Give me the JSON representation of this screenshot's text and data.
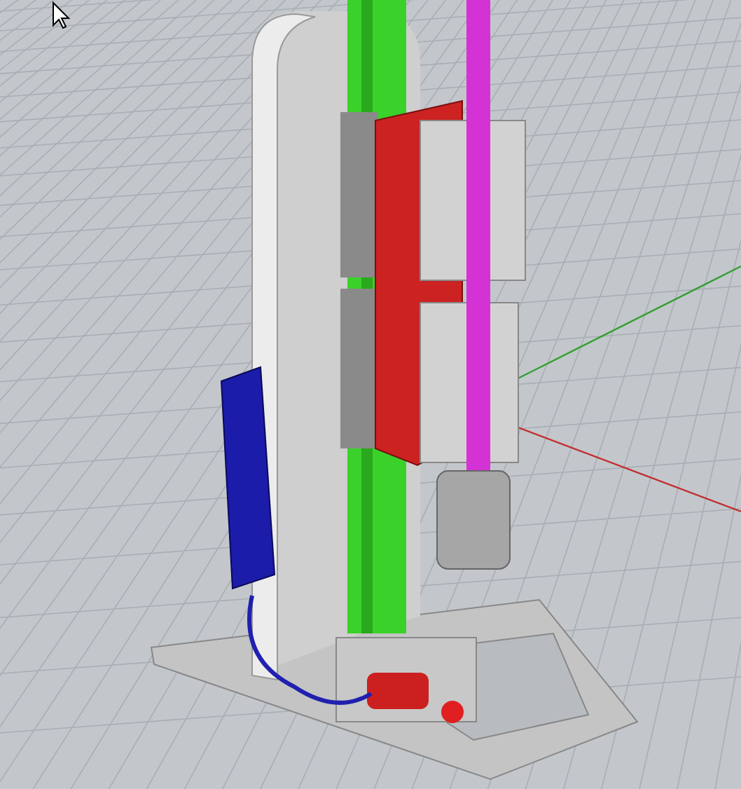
{
  "viewport": {
    "kind": "perspective",
    "grid": true,
    "axes": true,
    "cursor": true
  }
}
